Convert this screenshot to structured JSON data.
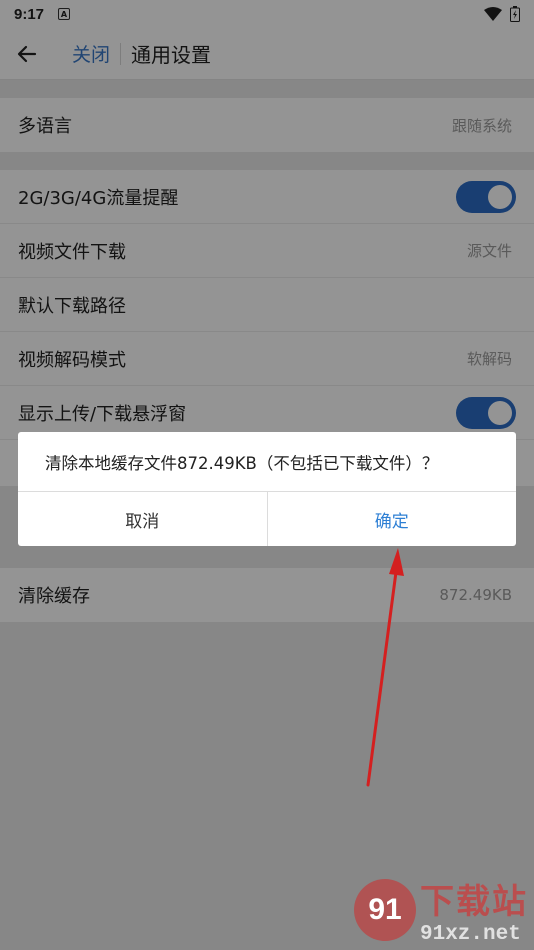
{
  "status_bar": {
    "time": "9:17",
    "notification_badge": "A"
  },
  "app_bar": {
    "close_label": "关闭",
    "title": "通用设置"
  },
  "settings": {
    "language": {
      "label": "多语言",
      "value": "跟随系统"
    },
    "network_reminder": {
      "label": "2G/3G/4G流量提醒",
      "enabled": true
    },
    "video_download": {
      "label": "视频文件下载",
      "value": "源文件"
    },
    "download_path": {
      "label": "默认下载路径"
    },
    "decode_mode": {
      "label": "视频解码模式",
      "value": "软解码"
    },
    "float_window": {
      "label": "显示上传/下载悬浮窗",
      "enabled": true
    },
    "clear_cache": {
      "label": "清除缓存",
      "value": "872.49KB"
    }
  },
  "dialog": {
    "message": "清除本地缓存文件872.49KB（不包括已下载文件）？",
    "cancel_label": "取消",
    "confirm_label": "确定"
  },
  "watermark": {
    "logo_text": "91",
    "site_name": "下载站",
    "url": "91xz.net"
  },
  "colors": {
    "accent": "#2b6cc4",
    "confirm": "#2d7fd4",
    "annotation_arrow": "#d42020"
  }
}
